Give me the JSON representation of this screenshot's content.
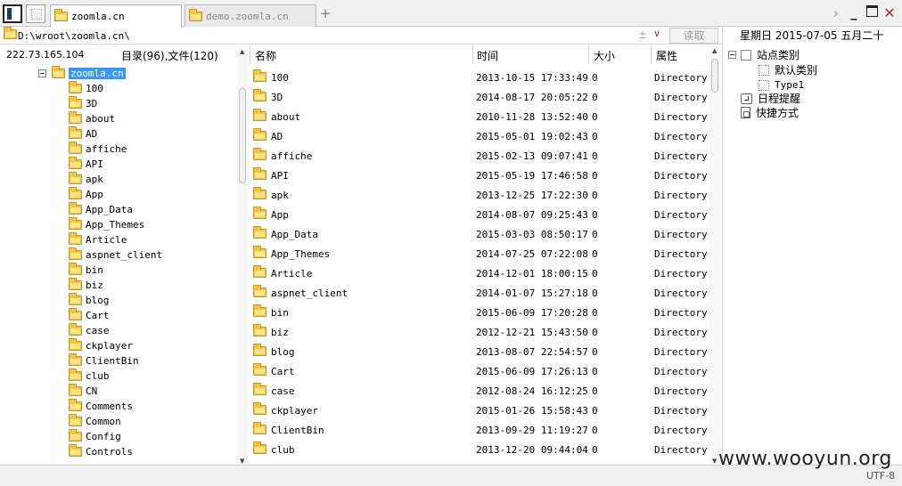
{
  "tabs": [
    {
      "label": "zoomla.cn",
      "active": true
    },
    {
      "label": "demo.zoomla.cn",
      "active": false
    }
  ],
  "address": {
    "value": "D:\\wroot\\zoomla.cn\\",
    "read_label": "读取"
  },
  "date": {
    "text": "星期日 2015-07-05 五月二十"
  },
  "info": {
    "ip": "222.73.165.104",
    "counts": "目录(96),文件(120)"
  },
  "columns": {
    "name": "名称",
    "time": "时间",
    "size": "大小",
    "attr": "属性"
  },
  "tree": {
    "root": "zoomla.cn",
    "items": [
      "100",
      "3D",
      "about",
      "AD",
      "affiche",
      "API",
      "apk",
      "App",
      "App_Data",
      "App_Themes",
      "Article",
      "aspnet_client",
      "bin",
      "biz",
      "blog",
      "Cart",
      "case",
      "ckplayer",
      "ClientBin",
      "club",
      "CN",
      "Comments",
      "Common",
      "Config",
      "Controls"
    ]
  },
  "files": [
    {
      "name": "100",
      "time": "2013-10-15 17:33:49",
      "size": "0",
      "attr": "Directory"
    },
    {
      "name": "3D",
      "time": "2014-08-17 20:05:22",
      "size": "0",
      "attr": "Directory"
    },
    {
      "name": "about",
      "time": "2010-11-28 13:52:40",
      "size": "0",
      "attr": "Directory"
    },
    {
      "name": "AD",
      "time": "2015-05-01 19:02:43",
      "size": "0",
      "attr": "Directory"
    },
    {
      "name": "affiche",
      "time": "2015-02-13 09:07:41",
      "size": "0",
      "attr": "Directory"
    },
    {
      "name": "API",
      "time": "2015-05-19 17:46:58",
      "size": "0",
      "attr": "Directory"
    },
    {
      "name": "apk",
      "time": "2013-12-25 17:22:30",
      "size": "0",
      "attr": "Directory"
    },
    {
      "name": "App",
      "time": "2014-08-07 09:25:43",
      "size": "0",
      "attr": "Directory"
    },
    {
      "name": "App_Data",
      "time": "2015-03-03 08:50:17",
      "size": "0",
      "attr": "Directory"
    },
    {
      "name": "App_Themes",
      "time": "2014-07-25 07:22:08",
      "size": "0",
      "attr": "Directory"
    },
    {
      "name": "Article",
      "time": "2014-12-01 18:00:15",
      "size": "0",
      "attr": "Directory"
    },
    {
      "name": "aspnet_client",
      "time": "2014-01-07 15:27:18",
      "size": "0",
      "attr": "Directory"
    },
    {
      "name": "bin",
      "time": "2015-06-09 17:20:28",
      "size": "0",
      "attr": "Directory"
    },
    {
      "name": "biz",
      "time": "2012-12-21 15:43:50",
      "size": "0",
      "attr": "Directory"
    },
    {
      "name": "blog",
      "time": "2013-08-07 22:54:57",
      "size": "0",
      "attr": "Directory"
    },
    {
      "name": "Cart",
      "time": "2015-06-09 17:26:13",
      "size": "0",
      "attr": "Directory"
    },
    {
      "name": "case",
      "time": "2012-08-24 16:12:25",
      "size": "0",
      "attr": "Directory"
    },
    {
      "name": "ckplayer",
      "time": "2015-01-26 15:58:43",
      "size": "0",
      "attr": "Directory"
    },
    {
      "name": "ClientBin",
      "time": "2013-09-29 11:19:27",
      "size": "0",
      "attr": "Directory"
    },
    {
      "name": "club",
      "time": "2013-12-20 09:44:04",
      "size": "0",
      "attr": "Directory"
    }
  ],
  "side": {
    "site_category": "站点类别",
    "default_category": "默认类别",
    "type1": "Type1",
    "schedule": "日程提醒",
    "shortcut": "快捷方式"
  },
  "status": {
    "watermark": "www.wooyun.org",
    "encoding": "UTF-8"
  }
}
